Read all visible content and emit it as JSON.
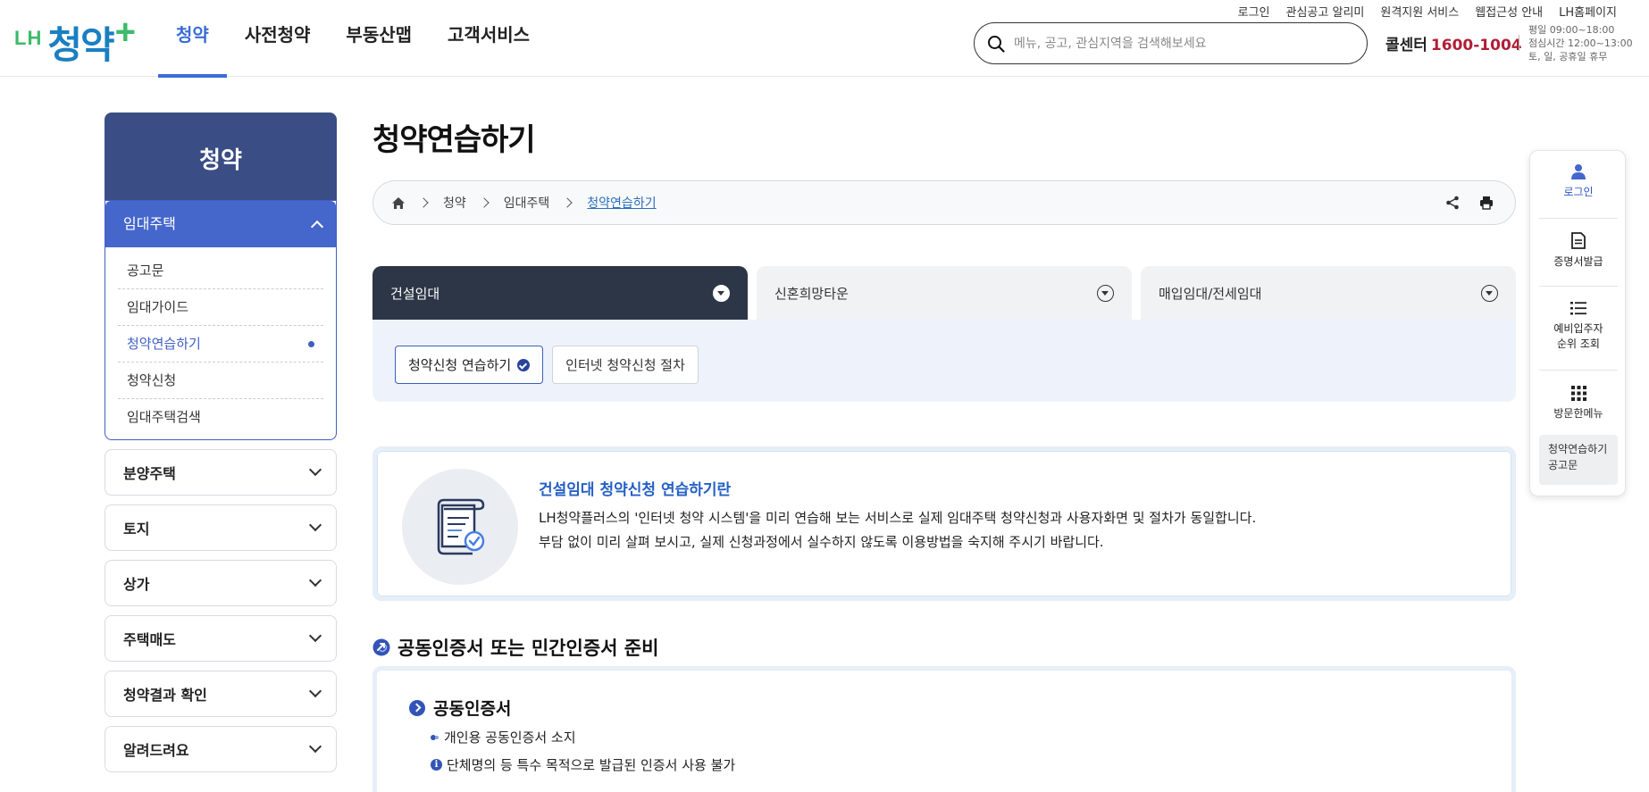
{
  "header": {
    "logo": {
      "prefix": "LH",
      "main": "청약",
      "plus": "+"
    },
    "gnb": [
      "청약",
      "사전청약",
      "부동산맵",
      "고객서비스"
    ],
    "util_links": [
      "로그인",
      "관심공고 알리미",
      "원격지원 서비스",
      "웹접근성 안내",
      "LH홈페이지"
    ],
    "search": {
      "placeholder": "메뉴, 공고, 관심지역을 검색해보세요",
      "icon": "search-icon"
    },
    "callcenter": {
      "label": "콜센터",
      "number": "1600-1004"
    },
    "hours": [
      "평일 09:00~18:00",
      "점심시간 12:00~13:00",
      "토, 일, 공휴일 휴무"
    ]
  },
  "sidebar": {
    "title": "청약",
    "open_group": {
      "label": "임대주택",
      "items": [
        "공고문",
        "임대가이드",
        "청약연습하기",
        "청약신청",
        "임대주택검색"
      ]
    },
    "groups": [
      "분양주택",
      "토지",
      "상가",
      "주택매도",
      "청약결과 확인",
      "알려드려요"
    ]
  },
  "main": {
    "title": "청약연습하기",
    "breadcrumb": [
      "청약",
      "임대주택",
      "청약연습하기"
    ],
    "tabs": [
      "건설임대",
      "신혼희망타운",
      "매입임대/전세임대"
    ],
    "subtabs": [
      "청약신청 연습하기",
      "인터넷 청약신청 절차"
    ],
    "intro": {
      "title": "건설임대 청약신청 연습하기란",
      "line1": "LH청약플러스의 '인터넷 청약 시스템'을 미리 연습해 보는 서비스로 실제 임대주택 청약신청과 사용자화면 및 절차가 동일합니다.",
      "line2": "부담 없이 미리 살펴 보시고, 실제 신청과정에서 실수하지 않도록 이용방법을 숙지해 주시기 바랍니다."
    },
    "section": {
      "title": "공동인증서 또는 민간인증서 준비",
      "sub_title": "공동인증서",
      "item1": "개인용 공동인증서 소지",
      "item2": "단체명의 등 특수 목적으로 발급된 인증서 사용 불가"
    }
  },
  "quick_menu": {
    "items": [
      "로그인",
      "증명서발급",
      "예비입주자",
      "순위 조회",
      "방문한메뉴"
    ],
    "recent": [
      "청약연습하기",
      "공고문"
    ]
  },
  "colors": {
    "primary": "#3a6cd6",
    "sidebar_header": "#3a4d84",
    "active_tab": "#2c3646",
    "callcenter_number": "#b01e36",
    "logo_blue": "#1a7fc1",
    "logo_green": "#3dba6a"
  }
}
